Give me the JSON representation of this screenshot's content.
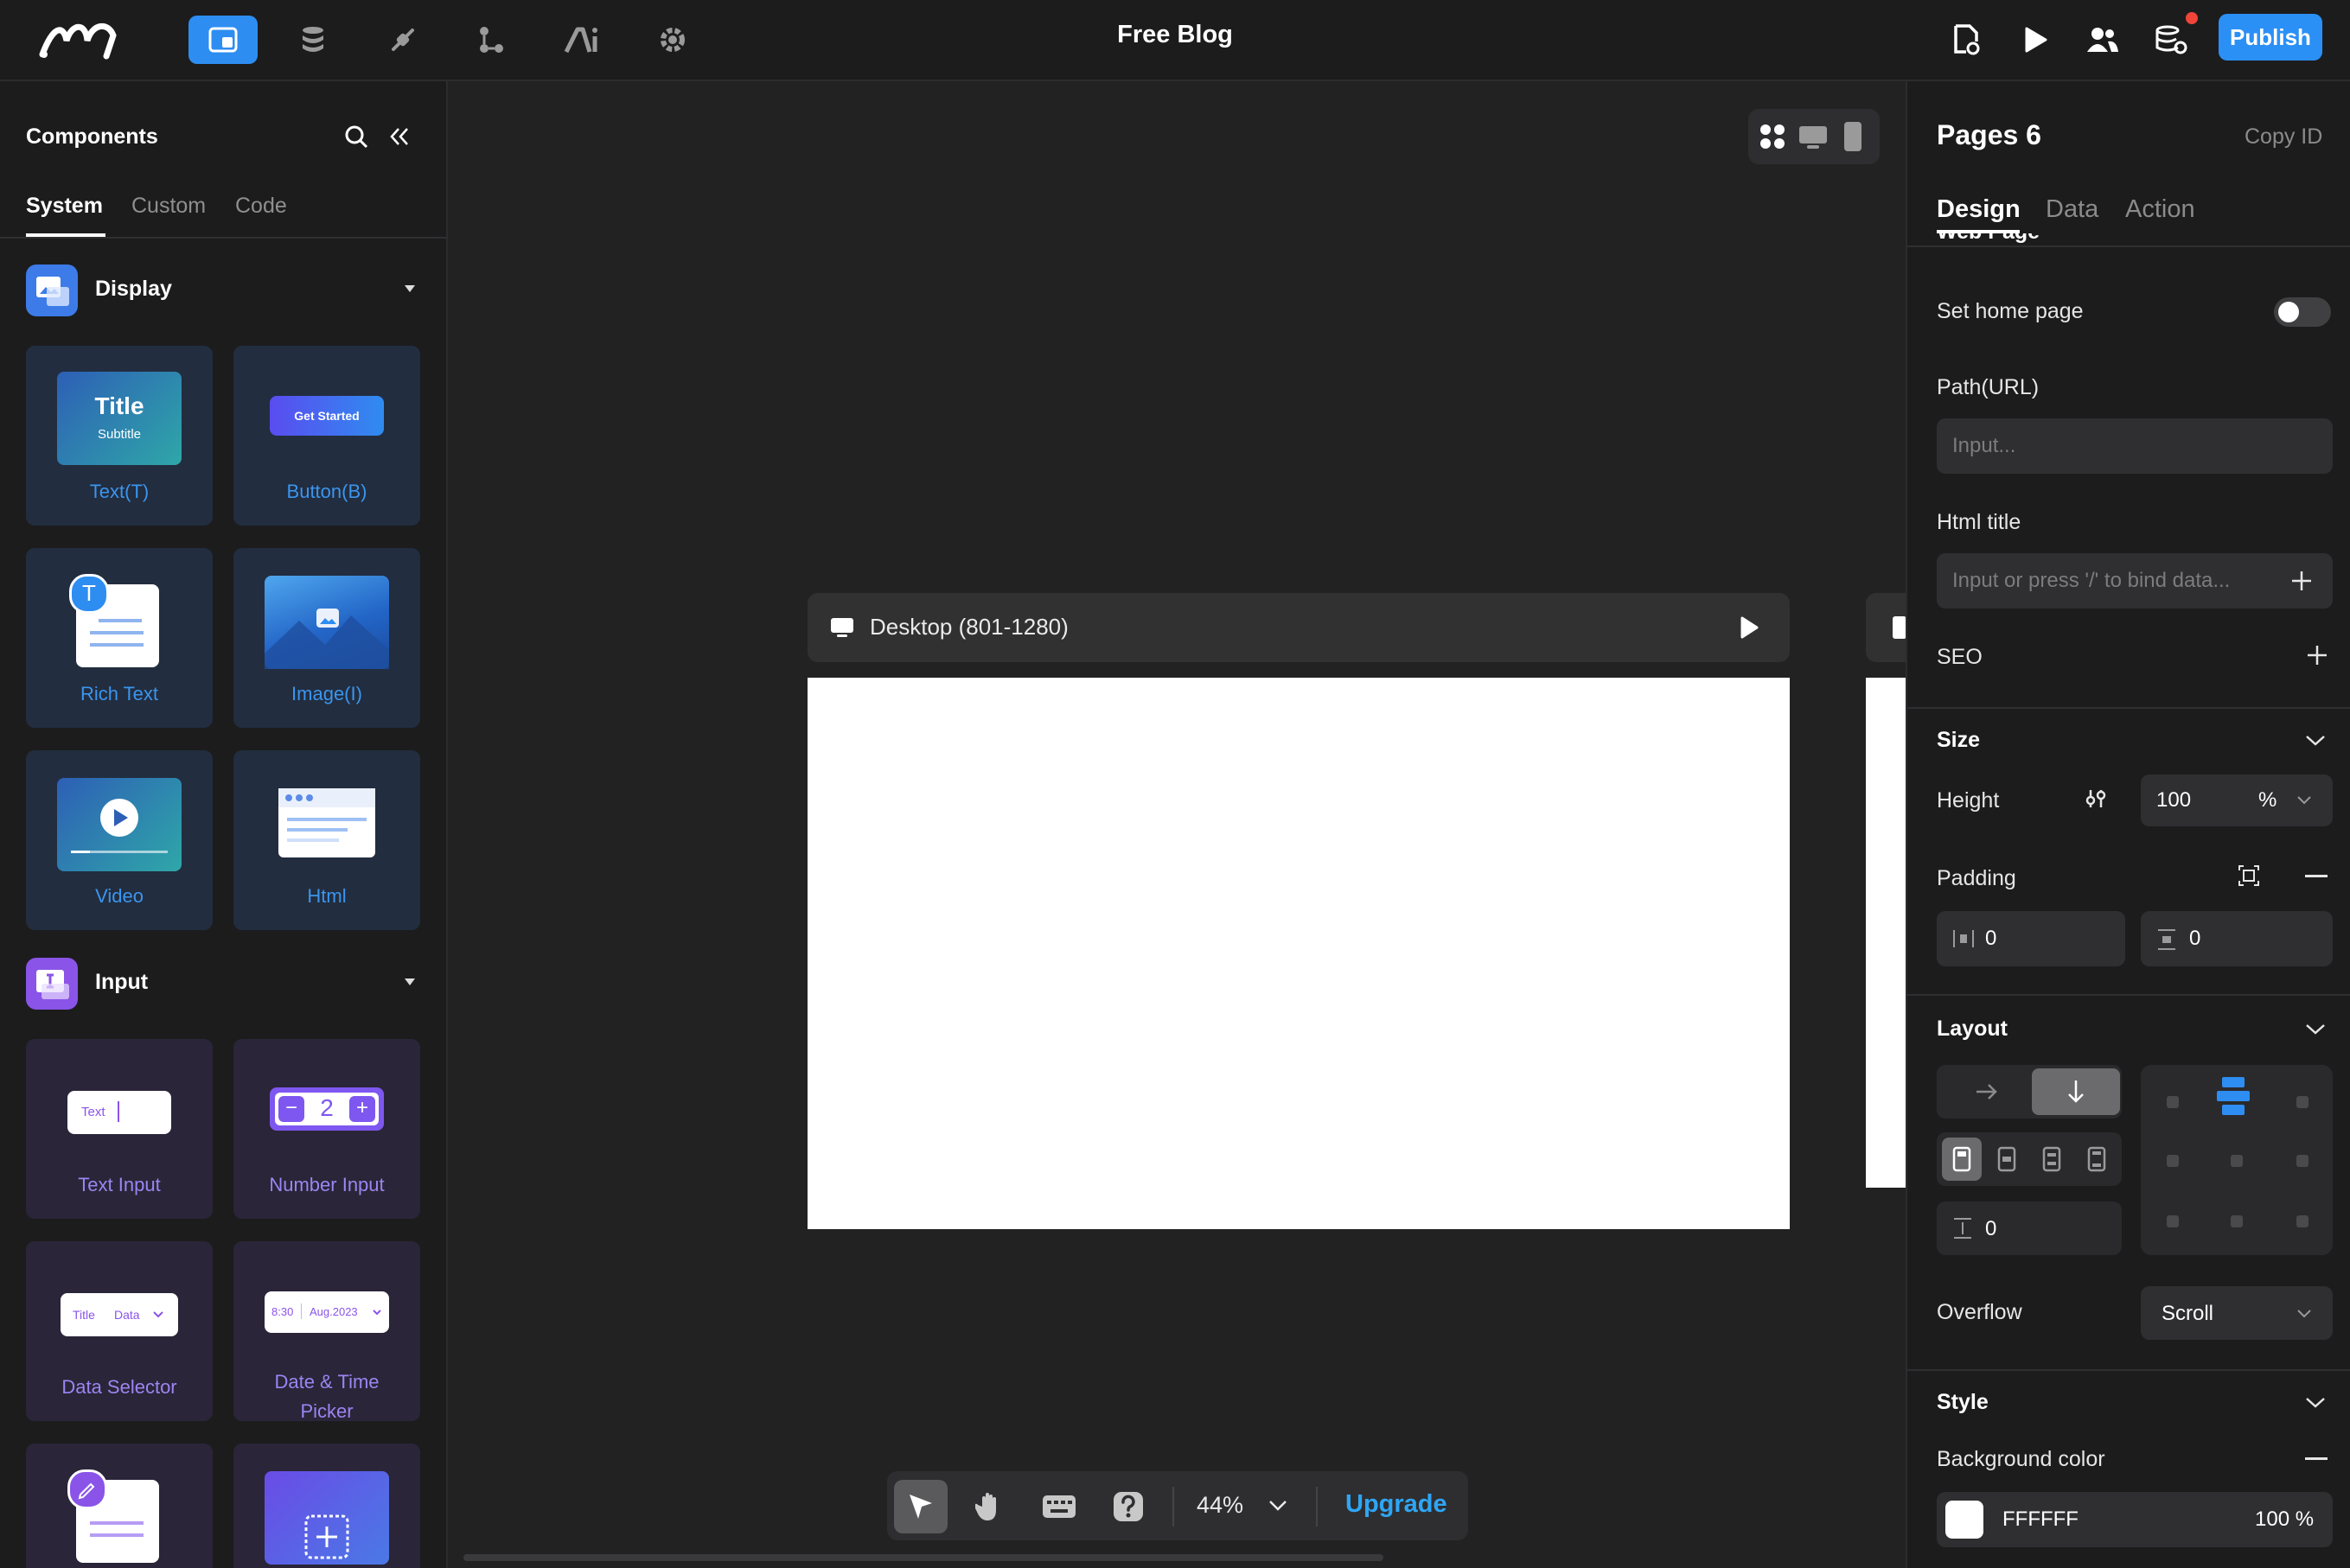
{
  "app": {
    "title": "Free Blog",
    "publish_label": "Publish",
    "brand_color": "#2b90f5",
    "toolbar_icons": [
      "components-icon",
      "database-icon",
      "plugin-icon",
      "workflow-icon",
      "ai-icon",
      "settings-icon"
    ],
    "right_icons": [
      "page-settings-icon",
      "preview-play-icon",
      "users-icon",
      "data-sync-icon"
    ]
  },
  "left_panel": {
    "title": "Components",
    "tabs": [
      "System",
      "Custom",
      "Code"
    ],
    "active_tab": "System",
    "sections": [
      {
        "label": "Display",
        "items": [
          "Text(T)",
          "Button(B)",
          "Rich Text",
          "Image(I)",
          "Video",
          "Html"
        ]
      },
      {
        "label": "Input",
        "items": [
          "Text Input",
          "Number Input",
          "Data Selector",
          "Date & Time Picker"
        ]
      }
    ],
    "thumbs": {
      "title_title": "Title",
      "title_subtitle": "Subtitle",
      "button_text": "Get Started",
      "richtext_badge": "T",
      "textinput_text": "Text",
      "number_value": "2",
      "selector_title": "Title",
      "selector_data": "Data",
      "date_time": "8:30",
      "date_date": "Aug.2023"
    }
  },
  "canvas": {
    "frame_title": "Desktop (801-1280)",
    "zoom": "44%",
    "upgrade_label": "Upgrade"
  },
  "right_panel": {
    "title": "Pages 6",
    "copy_id_label": "Copy ID",
    "tabs": [
      "Design",
      "Data",
      "Action"
    ],
    "active_tab": "Design",
    "truncated_heading": "Web Page",
    "set_home_label": "Set home page",
    "set_home_on": false,
    "path_label": "Path(URL)",
    "path_placeholder": "Input...",
    "html_title_label": "Html title",
    "html_title_placeholder": "Input or press '/' to bind data...",
    "seo_label": "SEO",
    "size": {
      "heading": "Size",
      "height_label": "Height",
      "height_value": "100",
      "height_unit": "%",
      "padding_label": "Padding",
      "padding_horizontal": "0",
      "padding_vertical": "0"
    },
    "layout": {
      "heading": "Layout",
      "direction": "vertical",
      "gap_value": "0",
      "overflow_label": "Overflow",
      "overflow_value": "Scroll"
    },
    "style": {
      "heading": "Style",
      "bg_label": "Background color",
      "bg_hex": "FFFFFF",
      "bg_opacity": "100 %"
    }
  }
}
